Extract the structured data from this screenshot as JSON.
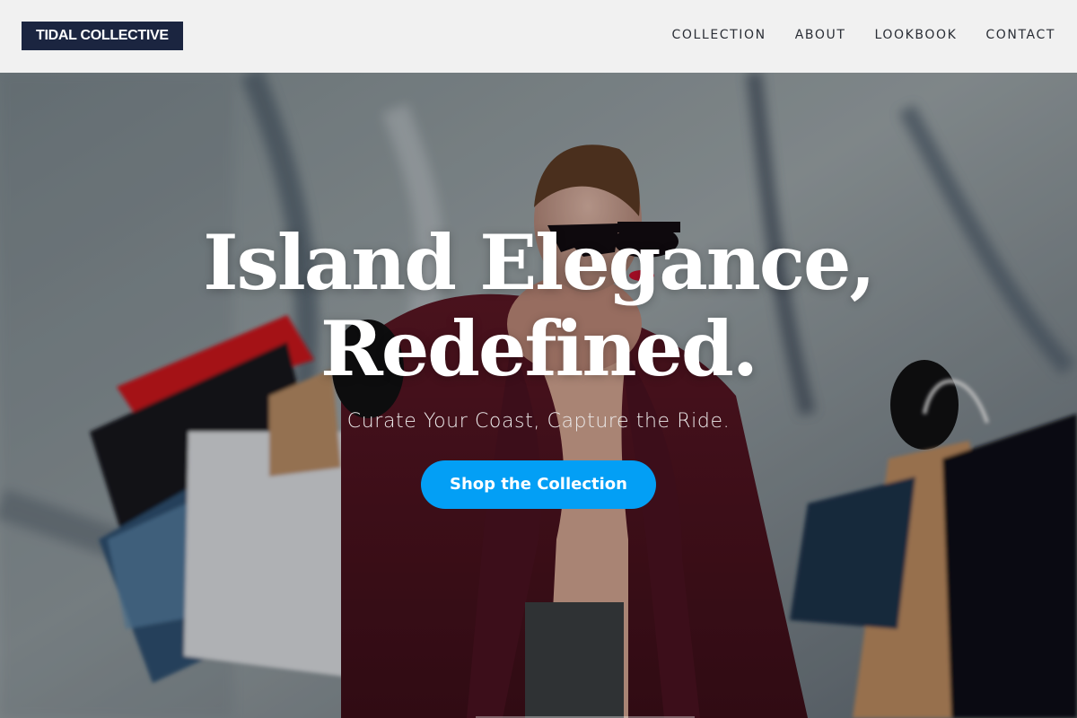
{
  "header": {
    "logo": "TIDAL COLLECTIVE",
    "nav": [
      "COLLECTION",
      "ABOUT",
      "LOOKBOOK",
      "CONTACT"
    ]
  },
  "hero": {
    "title_line1": "Island Elegance,",
    "title_line2": "Redefined.",
    "subtitle": "Curate Your Coast, Capture the Ride.",
    "cta_label": "Shop the Collection",
    "photo": "woman-with-shopping-bags-photo"
  },
  "colors": {
    "header_bg": "#f1f1f1",
    "logo_bg": "#1b2540",
    "cta_bg": "#039ff5",
    "text_light": "#ffffff",
    "nav_text": "#2a2e36"
  }
}
